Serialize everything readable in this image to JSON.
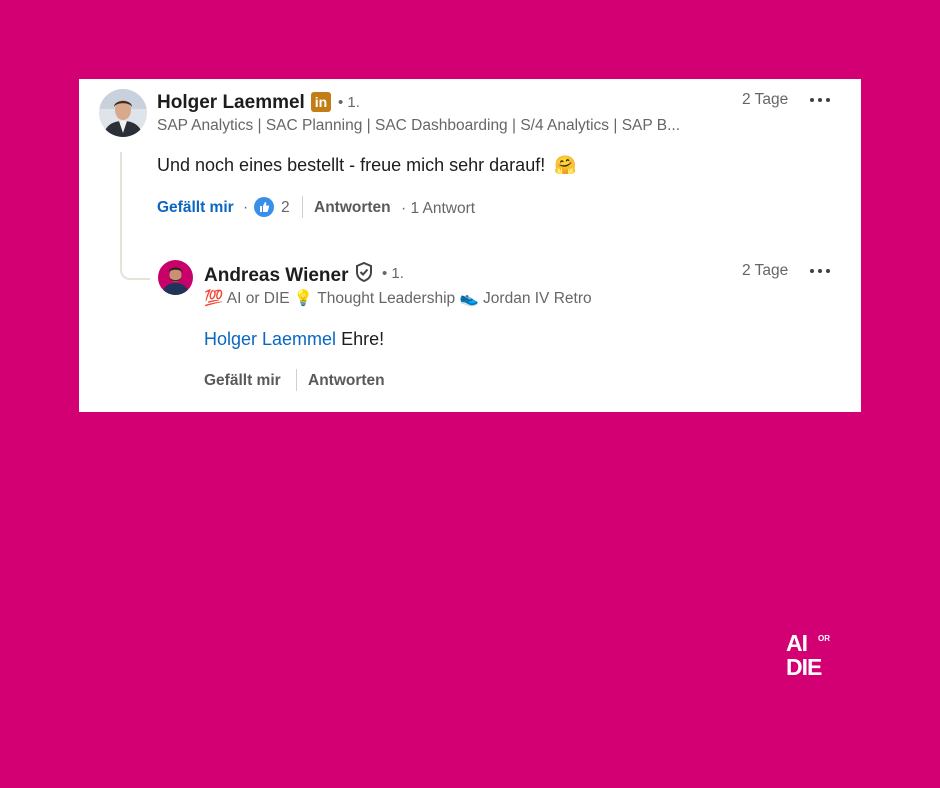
{
  "comment": {
    "author": "Holger Laemmel",
    "badge_icon": "linkedin-icon",
    "degree": "• 1.",
    "headline": "SAP Analytics | SAC Planning | SAC Dashboarding | S/4 Analytics | SAP B...",
    "time": "2 Tage",
    "text": "Und noch eines bestellt - freue mich sehr darauf!",
    "emoji": "🤗",
    "like_label": "Gefällt mir",
    "separator": "·",
    "reaction_icon": "like-reaction-icon",
    "reaction_count": "2",
    "reply_label": "Antworten",
    "reply_count": "· 1 Antwort"
  },
  "reply": {
    "author": "Andreas Wiener",
    "badge_icon": "verified-shield-icon",
    "degree": "• 1.",
    "headline": "💯 AI or DIE 💡 Thought Leadership 👟 Jordan IV Retro",
    "time": "2 Tage",
    "mention": "Holger Laemmel",
    "text": " Ehre!",
    "like_label": "Gefällt mir",
    "reply_label": "Antworten"
  },
  "logo": {
    "line1": "AI",
    "small": "OR",
    "line2": "DIE"
  },
  "colors": {
    "background": "#d20073",
    "card": "#ffffff",
    "link": "#0a66c2",
    "linkedin_badge": "#c37d16"
  }
}
